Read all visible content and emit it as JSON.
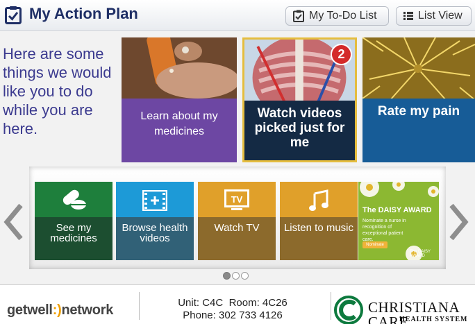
{
  "header": {
    "title": "My Action Plan",
    "todo_button": "My To-Do List",
    "list_button": "List View"
  },
  "intro": "Here are some things we would like you to do while you are here.",
  "tiles": [
    {
      "label": "Learn about my medicines",
      "color": "#6d47a3"
    },
    {
      "label": "Watch videos picked just for me",
      "badge": "2",
      "color": "#142a44"
    },
    {
      "label": "Rate my pain",
      "color": "#175c97"
    }
  ],
  "carousel": [
    {
      "label": "See my medicines",
      "icon": "pills-icon",
      "top_color": "#1e7f3c",
      "bottom_color": "#1c4e30"
    },
    {
      "label": "Browse health videos",
      "icon": "film-icon",
      "top_color": "#1d9ad7",
      "bottom_color": "#316177"
    },
    {
      "label": "Watch TV",
      "icon": "tv-icon",
      "top_color": "#e0a02a",
      "bottom_color": "#8c6a2c"
    },
    {
      "label": "Listen to music",
      "icon": "music-icon",
      "top_color": "#e0a02a",
      "bottom_color": "#8c6a2c"
    },
    {
      "label": "The DAISY AWARD",
      "line1": "Nominate a nurse in recognition of exceptional patient care.",
      "button": "Nominate",
      "footer": "The DAISY AWARD",
      "color": "#8cb832"
    }
  ],
  "pager": {
    "pages": 3,
    "active": 1
  },
  "footer": {
    "brand_left": "getwell",
    "brand_smile": ":)",
    "brand_right": "network",
    "unit": "Unit: C4C  Room: 4C26",
    "phone": "Phone: 302 733 4126",
    "hospital": "CHRISTIANA CARE",
    "hospital_sub": "HEALTH SYSTEM"
  }
}
